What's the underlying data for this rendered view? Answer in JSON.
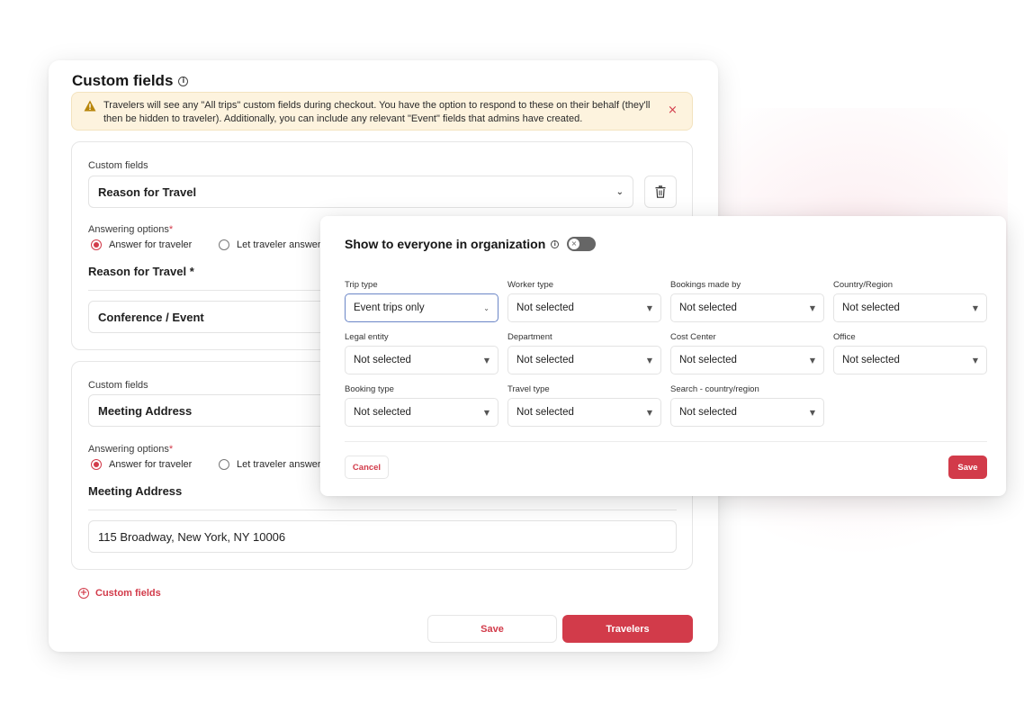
{
  "back": {
    "title": "Custom fields",
    "alert_text": "Travelers will see any \"All trips\" custom fields during checkout. You have the option to respond to these on their behalf (they'll then be hidden to traveler). Additionally, you can include any relevant \"Event\" fields that admins have created.",
    "alert_close": "×",
    "sections": [
      {
        "field_label": "Custom fields",
        "field_value": "Reason for Travel",
        "answering_label": "Answering options",
        "required_mark": "*",
        "option_answer": "Answer for traveler",
        "option_let": "Let traveler answer",
        "question_title": "Reason for Travel *",
        "answer_value": "Conference / Event"
      },
      {
        "field_label": "Custom fields",
        "field_value": "Meeting Address",
        "answering_label": "Answering options",
        "required_mark": "*",
        "option_answer": "Answer for traveler",
        "option_let": "Let traveler answer",
        "question_title": "Meeting Address",
        "answer_value": "115 Broadway, New York, NY 10006"
      }
    ],
    "add_custom_fields": "Custom fields",
    "save_label": "Save",
    "travelers_label": "Travelers"
  },
  "dialog": {
    "title": "Show to everyone in organization",
    "toggle_on": false,
    "filters": [
      {
        "label": "Trip type",
        "value": "Event trips only"
      },
      {
        "label": "Worker type",
        "value": "Not selected"
      },
      {
        "label": "Bookings made by",
        "value": "Not selected"
      },
      {
        "label": "Country/Region",
        "value": "Not selected"
      },
      {
        "label": "Legal entity",
        "value": "Not selected"
      },
      {
        "label": "Department",
        "value": "Not selected"
      },
      {
        "label": "Cost Center",
        "value": "Not selected"
      },
      {
        "label": "Office",
        "value": "Not selected"
      },
      {
        "label": "Booking type",
        "value": "Not selected"
      },
      {
        "label": "Travel type",
        "value": "Not selected"
      },
      {
        "label": "Search - country/region",
        "value": "Not selected"
      }
    ],
    "cancel_label": "Cancel",
    "save_label": "Save"
  },
  "colors": {
    "accent": "#d23b4a",
    "alert_bg": "#fdf3de",
    "warning": "#b8860b"
  },
  "icons": [
    "info-icon",
    "warning-icon",
    "close-icon",
    "chevron-down-icon",
    "trash-icon",
    "plus-circle-icon",
    "toggle-x-icon"
  ]
}
